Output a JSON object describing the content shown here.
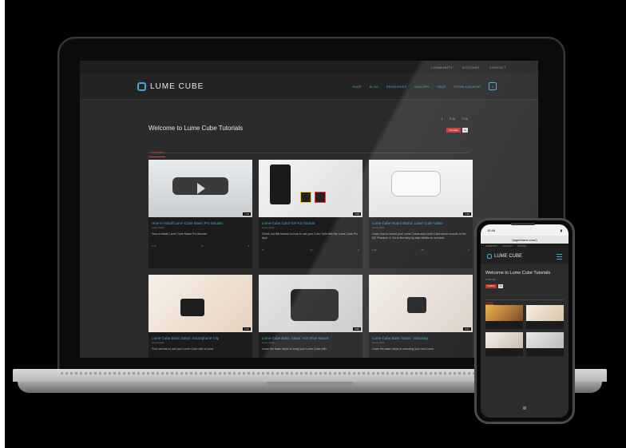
{
  "utility_nav": [
    "COMMUNITY",
    "ACCOUNT",
    "CONTACT"
  ],
  "brand": {
    "name": "LUME CUBE"
  },
  "main_nav": [
    "SHOP",
    "BLOG",
    "RESOURCES",
    "GALLERY",
    "FAQS",
    "STORE LOCATOR"
  ],
  "cart": {
    "label": "0"
  },
  "channel": {
    "title": "Welcome to Lume Cube Tutorials",
    "stats": [
      "1",
      "2.1k",
      "2.1k"
    ],
    "youtube_label": "YouTube",
    "youtube_count": "1k"
  },
  "tabs": {
    "active": "Tutorials"
  },
  "videos": [
    {
      "title": "How to Install Lume Cube Mavic Pro Mounts",
      "channel": "Lume Cube",
      "desc": "How to install Lume Cube Mavic Pro Mounts",
      "duration": "2:18",
      "views": "1.2k",
      "likes": "15",
      "comments": "3"
    },
    {
      "title": "Lume Cube Color Gel Kit Tutorial",
      "channel": "Lume Cube",
      "desc": "Check out this tutorial on how to use your Color Gels with the Lume Cube Pro App!",
      "duration": "1:03",
      "views": "1k",
      "likes": "12",
      "comments": "2"
    },
    {
      "title": "Lume Cube Mount Stand: Lume Cube Video",
      "channel": "Lume Cube",
      "desc": "Learn how to mount your Lume Cubes and Lume Cube drone mounts to the DJI Phantom 4. Go to find step-by-step details for a mount",
      "duration": "1:22",
      "views": "2.1k",
      "likes": "20",
      "comments": "4"
    },
    {
      "title": "Lume Cube Basic Steps: Smartphone Clip",
      "channel": "Lume Cube",
      "desc": "Find out how to use your Lume Cube with a Lume",
      "duration": "0:40",
      "views": "",
      "likes": "",
      "comments": ""
    },
    {
      "title": "Lume Cube Basic Steps: Hot Shoe Mount",
      "channel": "Lume Cube",
      "desc": "Learn the basic steps of using your Lume Cube with",
      "duration": "0:52",
      "views": "",
      "likes": "",
      "comments": ""
    },
    {
      "title": "Lume Cube Basic Steps: Unboxing",
      "channel": "Lume Cube",
      "desc": "Learn the basic steps to unboxing your new Lume",
      "duration": "0:47",
      "views": "",
      "likes": "",
      "comments": ""
    }
  ],
  "phone": {
    "status_time": "10:48",
    "url": "(lagerthane.com/)",
    "nav": [
      "COMMUNITY",
      "ACCOUNT",
      "CONTACT"
    ],
    "brand": "LUME CUBE",
    "title": "Welcome to Lume Cube Tutorials",
    "stats": "1  2.1k  2.1k",
    "youtube_label": "YouTube",
    "youtube_count": "1k",
    "tab": "Tutorials"
  }
}
